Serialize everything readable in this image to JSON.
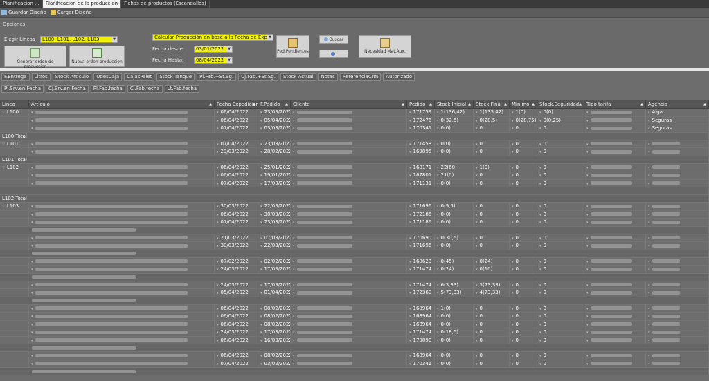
{
  "tabs": [
    {
      "label": "Planificacion ...",
      "active": false
    },
    {
      "label": "Planificacion de la produccion",
      "active": true
    },
    {
      "label": "Fichas de productos (Escandallos)",
      "active": false
    }
  ],
  "toolbar": {
    "save_label": "Guardar Diseño",
    "load_label": "Cargar Diseño"
  },
  "options": {
    "section_label": "Opciones",
    "lineas_label": "Elegir Lineas",
    "lineas_value": "L100, L101, L102, L103",
    "calc_value": "Calcular Producción en base a la Fecha de Expedición",
    "fecha_desde_label": "Fecha desde:",
    "fecha_desde_value": "03/01/2022",
    "fecha_hasta_label": "Fecha Hasta:",
    "fecha_hasta_value": "08/04/2022",
    "generar_label": "Generar orden de produccion",
    "nueva_label": "Nueva orden produccion",
    "ped_label": "Ped.Pendientes",
    "buscar_label": "Buscar",
    "necesidad_label": "Necesidad Mat.Aux."
  },
  "colchips_row1": [
    "F.Entrega",
    "Litros",
    "Stock Articulo",
    "UdesCaja",
    "CajasPalet",
    "Stock Tanque",
    "Pl.Fab.+St.Sg.",
    "Cj.Fab.+St.Sg.",
    "Stock Actual",
    "Notas",
    "ReferenciaCrm",
    "Autorizado"
  ],
  "colchips_row2": [
    "Pl.Srv.en Fecha",
    "Cj.Srv.en Fecha",
    "Pl.Fab.fecha",
    "Cj.Fab.fecha",
    "Lt.Fab.fecha"
  ],
  "grid_headers": [
    "Linea",
    "Articulo",
    "Fecha Expedicion",
    "F.Pedido",
    "Cliente",
    "Pedido",
    "Stock Inicial",
    "Stock Final",
    "Minimo",
    "Stock.Seguridad",
    "Tipo tarifa",
    "Agencia"
  ],
  "rows": [
    {
      "type": "data",
      "linea": "L100",
      "fexp": "06/04/2022",
      "fped": "23/03/2022",
      "pedido": "171759",
      "si": "1(136,42)",
      "sf": "1(135,42)",
      "min": "1(0)",
      "ss": "0(0)",
      "ag": "Alga"
    },
    {
      "type": "data",
      "linea": "",
      "fexp": "06/04/2022",
      "fped": "05/04/2022",
      "pedido": "172476",
      "si": "0(32,5)",
      "sf": "0(28,5)",
      "min": "0(28,75)",
      "ss": "0(0,25)",
      "ag": "Seguras"
    },
    {
      "type": "data",
      "linea": "",
      "fexp": "07/04/2022",
      "fped": "03/03/2022",
      "pedido": "170341",
      "si": "0(0)",
      "sf": "0",
      "min": "0",
      "ss": "0",
      "ag": "Seguras"
    },
    {
      "type": "total",
      "label": "L100 Total"
    },
    {
      "type": "data",
      "linea": "L101",
      "fexp": "07/04/2022",
      "fped": "23/03/2022",
      "pedido": "171458",
      "si": "0(0)",
      "sf": "0",
      "min": "0",
      "ss": "0",
      "ag": ""
    },
    {
      "type": "data",
      "linea": "",
      "fexp": "29/03/2022",
      "fped": "28/02/2022",
      "pedido": "169895",
      "si": "0(0)",
      "sf": "0",
      "min": "0",
      "ss": "0",
      "ag": ""
    },
    {
      "type": "total",
      "label": "L101 Total"
    },
    {
      "type": "data",
      "linea": "L102",
      "fexp": "06/04/2022",
      "fped": "25/01/2022",
      "pedido": "168171",
      "si": "22(60)",
      "sf": "1(0)",
      "min": "0",
      "ss": "0",
      "ag": ""
    },
    {
      "type": "data",
      "linea": "",
      "fexp": "06/04/2022",
      "fped": "19/01/2022",
      "pedido": "167801",
      "si": "21(0)",
      "sf": "0",
      "min": "0",
      "ss": "0",
      "ag": ""
    },
    {
      "type": "data",
      "linea": "",
      "fexp": "07/04/2022",
      "fped": "17/03/2022",
      "pedido": "171131",
      "si": "0(0)",
      "sf": "0",
      "min": "0",
      "ss": "0",
      "ag": ""
    },
    {
      "type": "blank"
    },
    {
      "type": "total",
      "label": "L102 Total"
    },
    {
      "type": "data",
      "linea": "L103",
      "fexp": "30/03/2022",
      "fped": "22/03/2022",
      "pedido": "171696",
      "si": "0(9,5)",
      "sf": "0",
      "min": "0",
      "ss": "0",
      "ag": ""
    },
    {
      "type": "data",
      "linea": "",
      "fexp": "06/04/2022",
      "fped": "30/03/2022",
      "pedido": "172186",
      "si": "0(0)",
      "sf": "0",
      "min": "0",
      "ss": "0",
      "ag": ""
    },
    {
      "type": "data",
      "linea": "",
      "fexp": "07/04/2022",
      "fped": "23/03/2022",
      "pedido": "171186",
      "si": "0(0)",
      "sf": "0",
      "min": "0",
      "ss": "0",
      "ag": ""
    },
    {
      "type": "group"
    },
    {
      "type": "data",
      "linea": "",
      "fexp": "21/03/2022",
      "fped": "07/03/2022",
      "pedido": "170690",
      "si": "0(30,5)",
      "sf": "0",
      "min": "0",
      "ss": "0",
      "ag": ""
    },
    {
      "type": "data",
      "linea": "",
      "fexp": "30/03/2022",
      "fped": "22/03/2022",
      "pedido": "171696",
      "si": "0(0)",
      "sf": "0",
      "min": "0",
      "ss": "0",
      "ag": ""
    },
    {
      "type": "group"
    },
    {
      "type": "data",
      "linea": "",
      "fexp": "07/02/2022",
      "fped": "02/02/2022",
      "pedido": "168623",
      "si": "0(45)",
      "sf": "0(24)",
      "min": "0",
      "ss": "0",
      "ag": ""
    },
    {
      "type": "data",
      "linea": "",
      "fexp": "24/03/2022",
      "fped": "17/03/2022",
      "pedido": "171474",
      "si": "0(24)",
      "sf": "0(10)",
      "min": "0",
      "ss": "0",
      "ag": ""
    },
    {
      "type": "group"
    },
    {
      "type": "data",
      "linea": "",
      "fexp": "24/03/2022",
      "fped": "17/03/2022",
      "pedido": "171474",
      "si": "6(3,33)",
      "sf": "5(73,33)",
      "min": "0",
      "ss": "0",
      "ag": ""
    },
    {
      "type": "data",
      "linea": "",
      "fexp": "05/04/2022",
      "fped": "01/04/2022",
      "pedido": "172360",
      "si": "5(73,33)",
      "sf": "4(73,33)",
      "min": "0",
      "ss": "0",
      "ag": ""
    },
    {
      "type": "group"
    },
    {
      "type": "data",
      "linea": "",
      "fexp": "06/04/2022",
      "fped": "08/02/2022",
      "pedido": "168964",
      "si": "1(0)",
      "sf": "0",
      "min": "0",
      "ss": "0",
      "ag": ""
    },
    {
      "type": "data",
      "linea": "",
      "fexp": "06/04/2022",
      "fped": "08/02/2022",
      "pedido": "168964",
      "si": "0(0)",
      "sf": "0",
      "min": "0",
      "ss": "0",
      "ag": ""
    },
    {
      "type": "data",
      "linea": "",
      "fexp": "06/04/2022",
      "fped": "08/02/2022",
      "pedido": "168964",
      "si": "0(0)",
      "sf": "0",
      "min": "0",
      "ss": "0",
      "ag": ""
    },
    {
      "type": "data",
      "linea": "",
      "fexp": "24/03/2022",
      "fped": "17/03/2022",
      "pedido": "171474",
      "si": "0(18,5)",
      "sf": "0",
      "min": "0",
      "ss": "0",
      "ag": ""
    },
    {
      "type": "data",
      "linea": "",
      "fexp": "06/04/2022",
      "fped": "16/03/2022",
      "pedido": "170890",
      "si": "0(0)",
      "sf": "0",
      "min": "0",
      "ss": "0",
      "ag": ""
    },
    {
      "type": "group"
    },
    {
      "type": "data",
      "linea": "",
      "fexp": "06/04/2022",
      "fped": "08/02/2022",
      "pedido": "168964",
      "si": "0(0)",
      "sf": "0",
      "min": "0",
      "ss": "0",
      "ag": ""
    },
    {
      "type": "data",
      "linea": "",
      "fexp": "07/04/2022",
      "fped": "03/02/2022",
      "pedido": "170341",
      "si": "0(0)",
      "sf": "0",
      "min": "0",
      "ss": "0",
      "ag": ""
    },
    {
      "type": "group"
    }
  ]
}
